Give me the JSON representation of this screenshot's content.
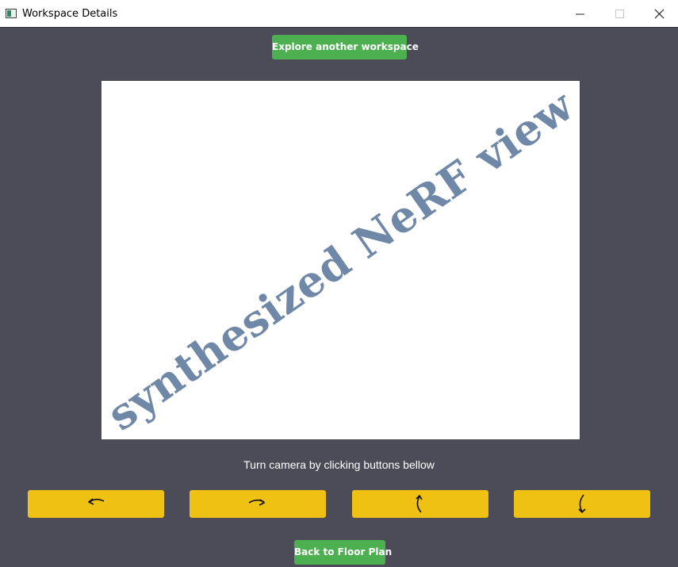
{
  "window": {
    "title": "Workspace Details",
    "app_icon": "window-app-icon",
    "controls": [
      "minimize-icon",
      "maximize-icon",
      "close-icon"
    ]
  },
  "header": {
    "explore_label": "Explore another workspace"
  },
  "view": {
    "watermark": "synthesized NeRF view"
  },
  "camera": {
    "instruction": "Turn camera by clicking buttons bellow",
    "buttons": [
      {
        "icon": "rotate-left-icon"
      },
      {
        "icon": "rotate-right-icon"
      },
      {
        "icon": "tilt-up-icon"
      },
      {
        "icon": "tilt-down-icon"
      }
    ]
  },
  "footer": {
    "back_label": "Back to Floor Plan"
  },
  "colors": {
    "background": "#4b4c58",
    "primary_green": "#4caf50",
    "control_yellow": "#efc112",
    "watermark": "#7088a8"
  }
}
